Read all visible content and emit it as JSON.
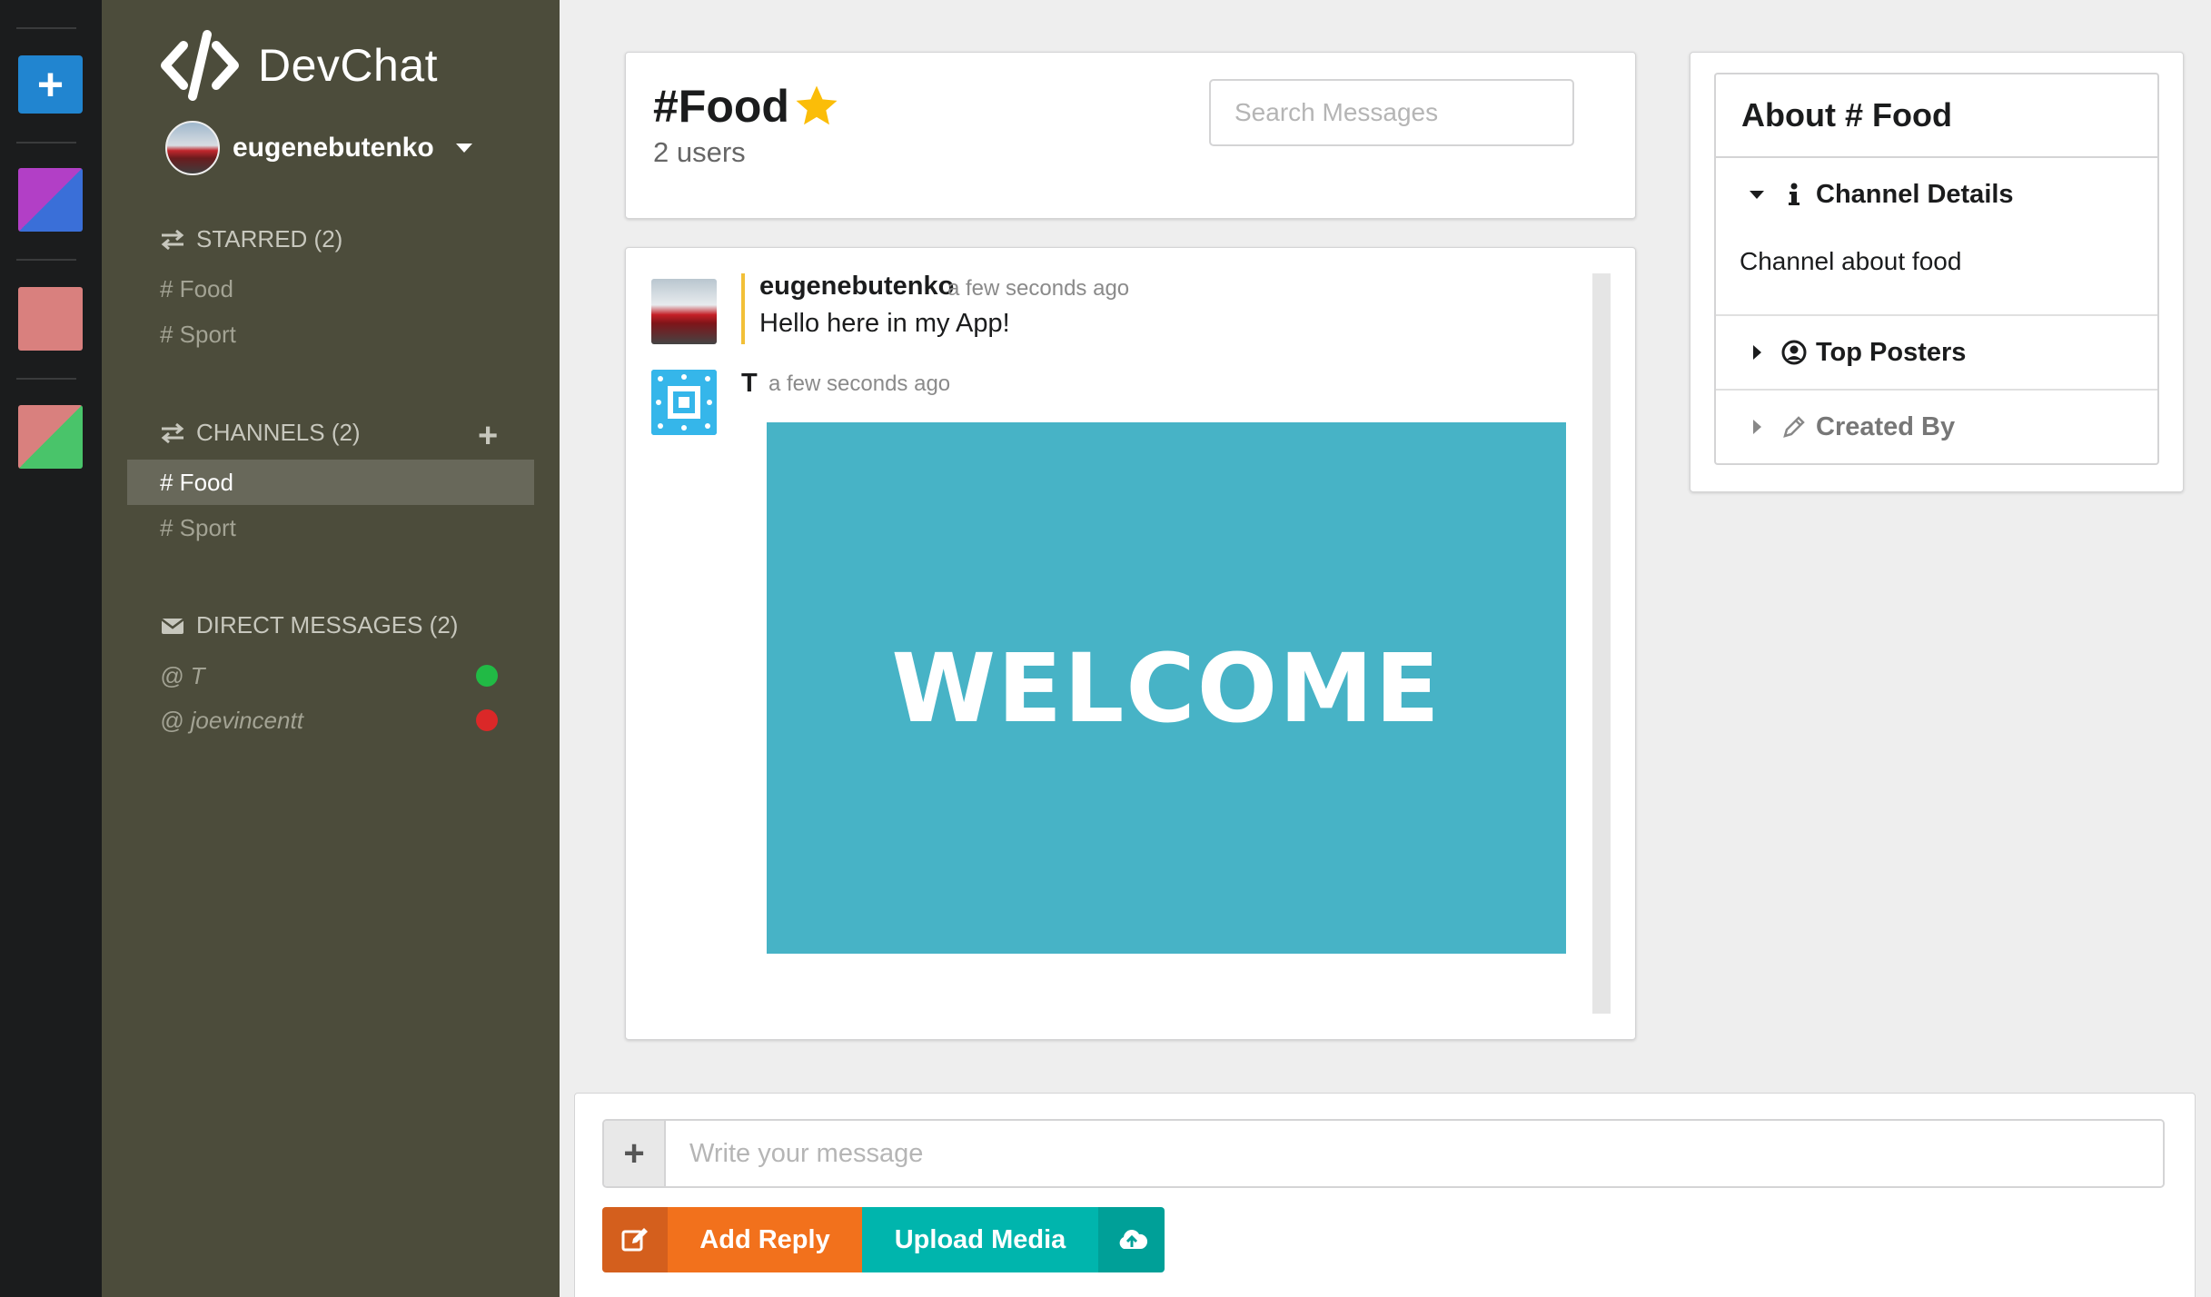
{
  "app": {
    "name": "DevChat",
    "colors": {
      "sidebar": "#4c4c3b",
      "color_panel": "#1b1c1d",
      "accent_blue": "#2185d0",
      "reply_orange": "#f2711c",
      "upload_teal": "#00b5ad",
      "welcome_bg": "#47b3c6",
      "online": "#21ba45",
      "offline": "#db2828"
    }
  },
  "color_panel": {
    "add_icon": "plus-icon",
    "swatches": [
      {
        "primary": "#3a6fd8",
        "secondary": "#b23fc6"
      },
      {
        "primary": "#d9807e",
        "secondary": "#d9807e"
      },
      {
        "primary": "#49c46a",
        "secondary": "#d9807e"
      }
    ]
  },
  "user": {
    "name": "eugenebutenko"
  },
  "starred": {
    "header": "STARRED (2)",
    "icon": "exchange-icon",
    "items": [
      {
        "label": "# Food"
      },
      {
        "label": "# Sport"
      }
    ]
  },
  "channels": {
    "header": "CHANNELS (2)",
    "icon": "exchange-icon",
    "add_icon": "plus-icon",
    "items": [
      {
        "label": "# Food",
        "active": true
      },
      {
        "label": "# Sport",
        "active": false
      }
    ]
  },
  "direct_messages": {
    "header": "DIRECT MESSAGES (2)",
    "icon": "mail-icon",
    "items": [
      {
        "label": "@ T",
        "status": "online"
      },
      {
        "label": "@ joevincentt",
        "status": "offline"
      }
    ]
  },
  "channel_header": {
    "title": "#Food",
    "starred": true,
    "user_count": "2 users",
    "search_placeholder": "Search Messages"
  },
  "messages": [
    {
      "author": "eugenebutenko",
      "time": "a few seconds ago",
      "text": "Hello here in my App!",
      "own": true
    },
    {
      "author": "T",
      "time": "a few seconds ago",
      "image_text": "WELCOME"
    }
  ],
  "meta_panel": {
    "title": "About # Food",
    "sections": [
      {
        "title": "Channel Details",
        "icon": "info-icon",
        "expanded": true,
        "content": "Channel about food"
      },
      {
        "title": "Top Posters",
        "icon": "user-circle-icon",
        "expanded": false
      },
      {
        "title": "Created By",
        "icon": "pencil-icon",
        "expanded": false
      }
    ]
  },
  "message_form": {
    "placeholder": "Write your message",
    "add_reply_label": "Add Reply",
    "upload_media_label": "Upload Media"
  }
}
